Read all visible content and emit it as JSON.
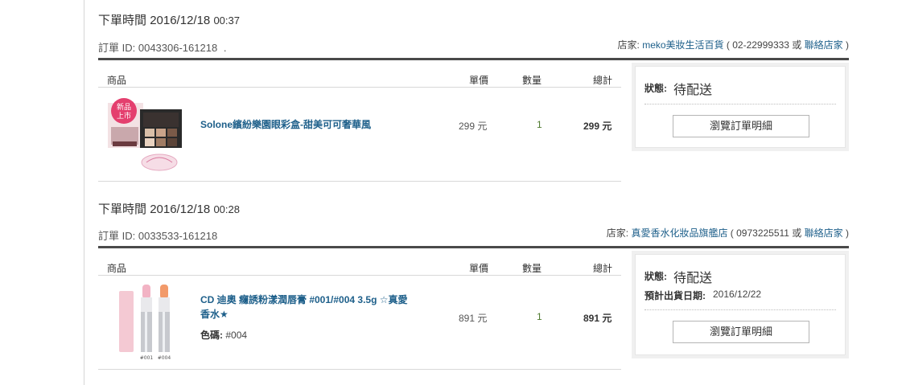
{
  "orders": [
    {
      "time_label": "下單時間",
      "time_value": "2016/12/18",
      "time_clock": "00:37",
      "id_label": "訂單 ID:",
      "id_value": "0043306-161218",
      "id_suffix": ".",
      "store_label": "店家:",
      "store_name": "meko美妝生活百貨",
      "store_phone": " ( 02-22999333 或 ",
      "store_contact": "聯絡店家",
      "store_close": " )",
      "headers": {
        "product": "商品",
        "price": "單價",
        "qty": "數量",
        "total": "總計"
      },
      "product_name": "Solone繽紛樂園眼彩盒-甜美可可奢華風",
      "product_image_badge": "新品上市",
      "price": "299 元",
      "qty": "1",
      "total": "299 元",
      "status_label": "狀態:",
      "status_value": "待配送",
      "button_label": "瀏覽訂單明細"
    },
    {
      "time_label": "下單時間",
      "time_value": "2016/12/18",
      "time_clock": "00:28",
      "id_label": "訂單 ID:",
      "id_value": "0033533-161218",
      "store_label": "店家:",
      "store_name": "真愛香水化妝品旗艦店",
      "store_phone": " ( 0973225511 或 ",
      "store_contact": "聯絡店家",
      "store_close": " )",
      "headers": {
        "product": "商品",
        "price": "單價",
        "qty": "數量",
        "total": "總計"
      },
      "product_name_line1": "CD 迪奧 癮誘粉漾潤唇膏 #001/#004 3.5g ☆真愛",
      "product_name_line2": "香水★",
      "color_label": "色碼:",
      "color_value": "#004",
      "image_tags": [
        "#001",
        "#004"
      ],
      "price": "891 元",
      "qty": "1",
      "total": "891 元",
      "status_label": "狀態:",
      "status_value": "待配送",
      "eta_label": "預計出貨日期:",
      "eta_value": "2016/12/22",
      "button_label": "瀏覽訂單明細"
    }
  ]
}
